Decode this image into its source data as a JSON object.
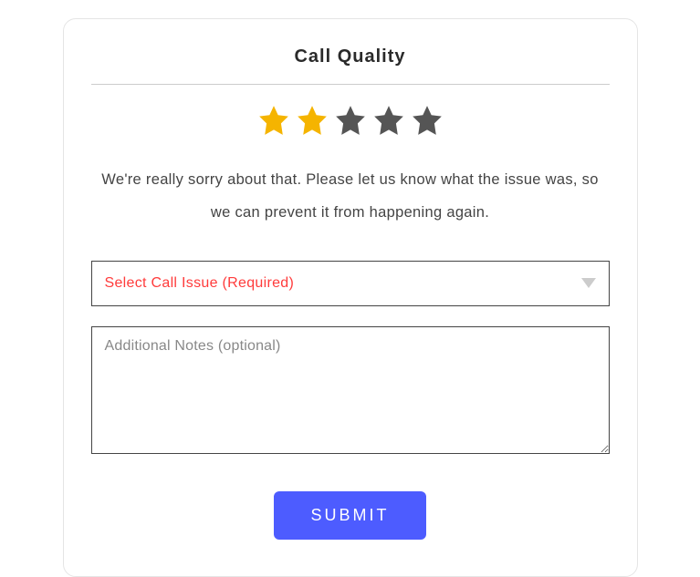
{
  "title": "Call Quality",
  "rating": {
    "value": 2,
    "max": 5,
    "filled_color": "#f5b400",
    "empty_color": "#555555"
  },
  "apology_text": "We're really sorry about that. Please let us know what the issue was, so we can prevent it from happening again.",
  "select": {
    "placeholder": "Select Call Issue (Required)",
    "error": true
  },
  "notes": {
    "placeholder": "Additional Notes (optional)",
    "value": ""
  },
  "submit_label": "SUBMIT",
  "colors": {
    "accent": "#4d5cff",
    "error": "#ff3b3b"
  }
}
